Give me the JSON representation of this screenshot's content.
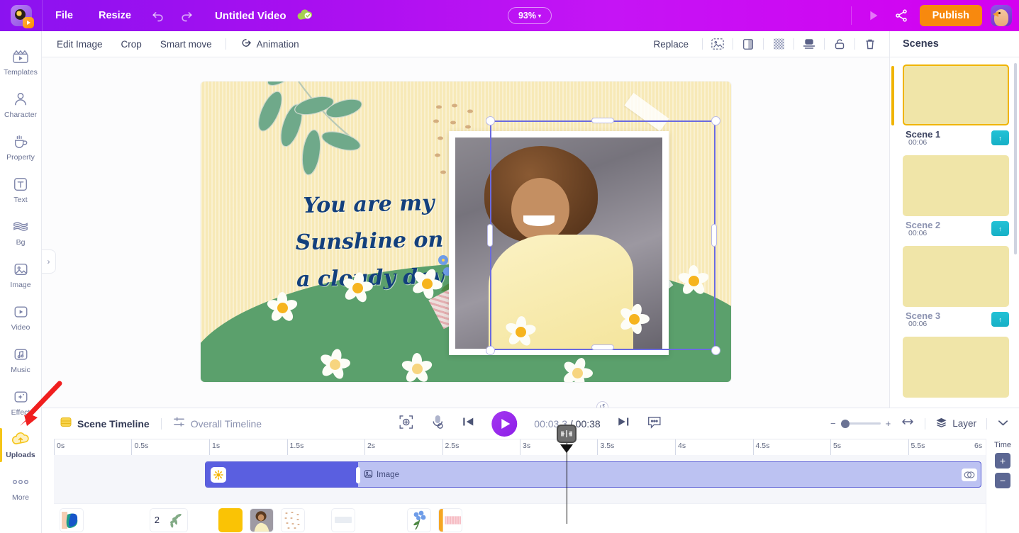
{
  "header": {
    "logo_icon": "app-logo-icon",
    "menu": [
      {
        "label": "File",
        "name": "file-menu"
      },
      {
        "label": "Resize",
        "name": "resize-menu"
      }
    ],
    "undo_icon": "undo-icon",
    "redo_icon": "redo-icon",
    "doc_title": "Untitled Video",
    "saved_icon": "cloud-saved-icon",
    "zoom_level": "93%",
    "zoom_caret": "▾",
    "preview_icon": "preview-play-icon",
    "share_icon": "share-icon",
    "publish_label": "Publish",
    "avatar_name": "user-avatar",
    "bg_color": "#a80ff0",
    "publish_color": "#f8890e"
  },
  "sidebar": {
    "items": [
      {
        "label": "Templates",
        "icon": "templates-icon",
        "active": false
      },
      {
        "label": "Character",
        "icon": "character-icon",
        "active": false
      },
      {
        "label": "Property",
        "icon": "property-icon",
        "active": false
      },
      {
        "label": "Text",
        "icon": "text-icon",
        "active": false
      },
      {
        "label": "Bg",
        "icon": "background-icon",
        "active": false
      },
      {
        "label": "Image",
        "icon": "image-icon",
        "active": false
      },
      {
        "label": "Video",
        "icon": "video-icon",
        "active": false
      },
      {
        "label": "Music",
        "icon": "music-icon",
        "active": false
      },
      {
        "label": "Effect",
        "icon": "effect-icon",
        "active": false
      },
      {
        "label": "Uploads",
        "icon": "uploads-cloud-icon",
        "active": true
      },
      {
        "label": "More",
        "icon": "more-dots-icon",
        "active": false
      }
    ]
  },
  "toolbar": {
    "edit_image": "Edit Image",
    "crop": "Crop",
    "smart_move": "Smart move",
    "animation": "Animation",
    "animation_icon": "animation-icon",
    "replace": "Replace",
    "icons": [
      {
        "name": "remove-background-icon"
      },
      {
        "name": "flip-mirror-icon"
      },
      {
        "name": "transparency-icon"
      },
      {
        "name": "layer-order-icon"
      },
      {
        "name": "lock-icon"
      },
      {
        "name": "delete-icon"
      }
    ]
  },
  "canvas": {
    "collapse_icon": "›",
    "text_lines": [
      "You are my",
      "Sunshine on",
      "a cloudy day"
    ],
    "text_color": "#13407d",
    "bg_color": "#f7e9b7",
    "hill_color": "#5ba06c",
    "selected_element": "photo-image",
    "rotate_icon": "↺"
  },
  "scenes": {
    "title": "Scenes",
    "list": [
      {
        "name": "Scene 1",
        "duration": "00:06",
        "selected": true,
        "up_icon": "↑"
      },
      {
        "name": "Scene 2",
        "duration": "00:06",
        "selected": false,
        "up_icon": "↑"
      },
      {
        "name": "Scene 3",
        "duration": "00:06",
        "selected": false,
        "up_icon": "↑"
      }
    ],
    "selected_color": "#f0b400"
  },
  "timeline": {
    "scene_tab": "Scene Timeline",
    "scene_tab_icon": "scene-timeline-icon",
    "overall_tab": "Overall Timeline",
    "overall_tab_icon": "overall-timeline-icon",
    "fit_icon": "fit-to-screen-icon",
    "voice_icon": "voiceover-mic-icon",
    "prev_icon": "skip-previous-icon",
    "play_icon": "play-icon",
    "next_icon": "skip-next-icon",
    "subtitle_icon": "subtitle-icon",
    "current_time": "00:03.3",
    "time_separator": "/",
    "total_time": "00:38",
    "zoom_minus": "−",
    "zoom_plus": "+",
    "fit_width_icon": "fit-width-icon",
    "layer_label": "Layer",
    "layer_icon": "layer-stack-icon",
    "collapse_icon": "chevron-down-icon",
    "ruler_ticks": [
      "0s",
      "0.5s",
      "1s",
      "1.5s",
      "2s",
      "2.5s",
      "3s",
      "3.5s",
      "4s",
      "4.5s",
      "5s",
      "5.5s",
      "6s"
    ],
    "time_col_label": "Time",
    "time_add": "+",
    "time_remove": "−",
    "clip": {
      "label": "Image",
      "label_icon": "image-clip-icon",
      "anim_icon": "animation-preset-icon",
      "end_icon": "clip-link-icon"
    },
    "playhead_icon": "playhead-split-icon",
    "layer_thumbs": [
      {
        "name": "layer-thumb-shape",
        "badge": ""
      },
      {
        "name": "layer-thumb-leaves",
        "badge": "2"
      },
      {
        "name": "layer-thumb-yellow",
        "badge": ""
      },
      {
        "name": "layer-thumb-photo",
        "badge": ""
      },
      {
        "name": "layer-thumb-dots",
        "badge": ""
      },
      {
        "name": "layer-thumb-tape",
        "badge": ""
      },
      {
        "name": "layer-thumb-flower",
        "badge": ""
      },
      {
        "name": "layer-thumb-washi",
        "badge": ""
      }
    ]
  },
  "annotation": {
    "arrow_color": "#f01f1f",
    "points_to": "Uploads"
  }
}
